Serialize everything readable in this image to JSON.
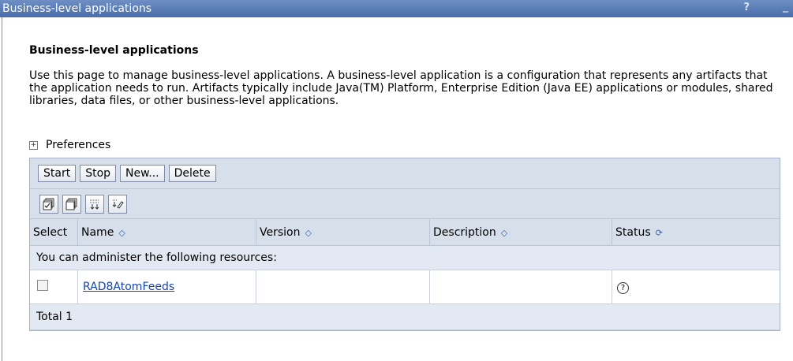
{
  "window": {
    "title": "Business-level applications",
    "help_label": "?",
    "minimize_label": "_"
  },
  "page": {
    "heading": "Business-level applications",
    "description": "Use this page to manage business-level applications. A business-level application is a configuration that represents any artifacts that the application needs to run. Artifacts typically include Java(TM) Platform, Enterprise Edition (Java EE) applications or modules, shared libraries, data files, or other business-level applications.",
    "preferences": {
      "label": "Preferences",
      "expander": "+"
    }
  },
  "toolbar": {
    "start": "Start",
    "stop": "Stop",
    "new": "New...",
    "delete": "Delete"
  },
  "icon_toolbar": [
    "select-all-icon",
    "deselect-all-icon",
    "show-filter-icon",
    "clear-filter-icon"
  ],
  "table": {
    "columns": {
      "select": "Select",
      "name": "Name",
      "version": "Version",
      "description": "Description",
      "status": "Status"
    },
    "sort_icon": "sort-icon",
    "refresh_icon": "refresh-status-icon",
    "resource_note": "You can administer the following resources:",
    "rows": [
      {
        "name": "RAD8AtomFeeds",
        "version": "",
        "description": "",
        "status": "unknown-status-icon"
      }
    ],
    "total": "Total 1"
  }
}
